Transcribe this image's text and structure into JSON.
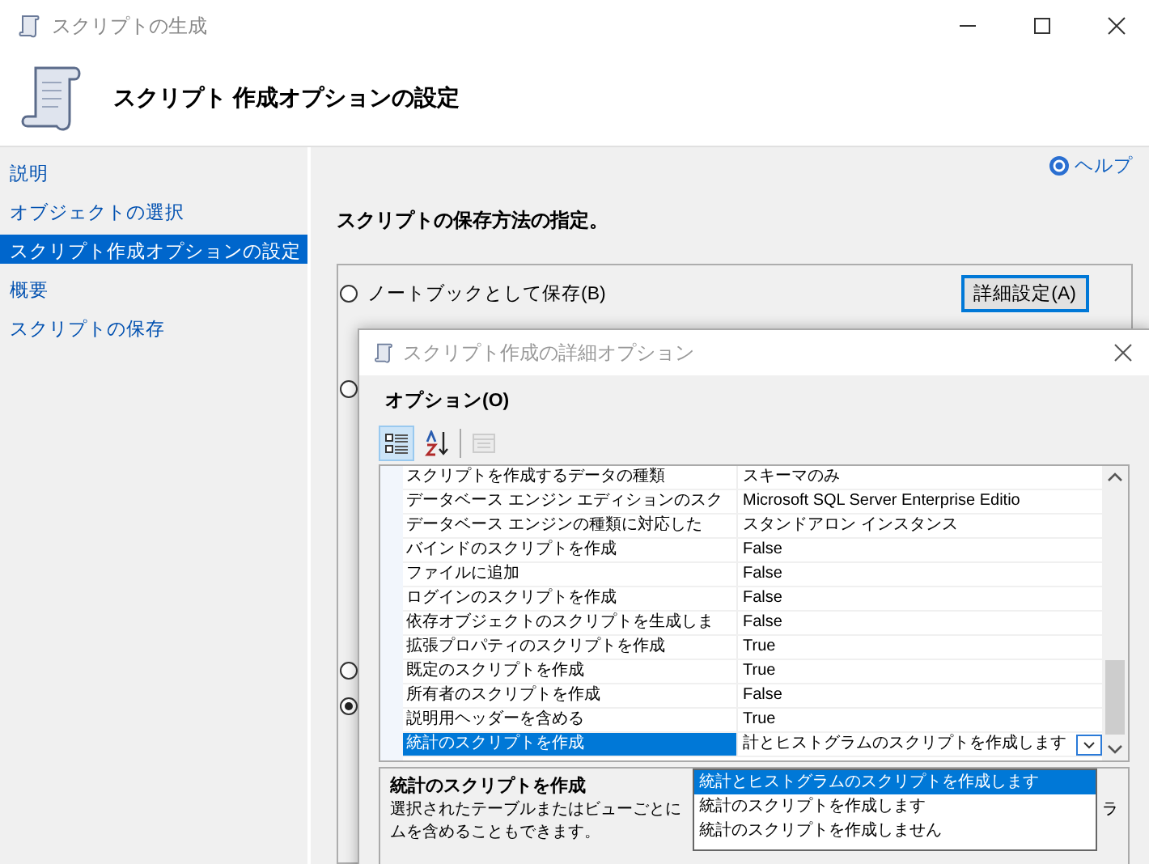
{
  "window": {
    "title": "スクリプトの生成"
  },
  "header": {
    "title": "スクリプト 作成オプションの設定"
  },
  "sidebar": {
    "items": [
      {
        "label": "説明",
        "selected": false
      },
      {
        "label": "オブジェクトの選択",
        "selected": false
      },
      {
        "label": "スクリプト作成オプションの設定",
        "selected": true
      },
      {
        "label": "概要",
        "selected": false
      },
      {
        "label": "スクリプトの保存",
        "selected": false
      }
    ]
  },
  "help_link": "ヘルプ",
  "heading": "スクリプトの保存方法の指定。",
  "save_options": [
    {
      "label": "ノートブックとして保存(B)",
      "selected": false
    },
    {
      "selected": false
    },
    {
      "selected": false
    },
    {
      "selected": true
    }
  ],
  "advanced_button": "詳細設定(A)",
  "dialog": {
    "title": "スクリプト作成の詳細オプション",
    "options_label": "オプション(O)",
    "toolbar": [
      {
        "kind": "categorized",
        "selected": true,
        "disabled": false
      },
      {
        "kind": "alphabetical",
        "selected": false,
        "disabled": false
      },
      {
        "kind": "property_pages",
        "selected": false,
        "disabled": true
      }
    ],
    "properties": [
      {
        "name": "スクリプトを作成するデータの種類",
        "value": "スキーマのみ",
        "selected": false
      },
      {
        "name": "データベース エンジン エディションのスク",
        "value": "Microsoft SQL Server Enterprise Editio",
        "selected": false
      },
      {
        "name": "データベース エンジンの種類に対応した",
        "value": "スタンドアロン インスタンス",
        "selected": false
      },
      {
        "name": "バインドのスクリプトを作成",
        "value": "False",
        "selected": false
      },
      {
        "name": "ファイルに追加",
        "value": "False",
        "selected": false
      },
      {
        "name": "ログインのスクリプトを作成",
        "value": "False",
        "selected": false
      },
      {
        "name": "依存オブジェクトのスクリプトを生成しま",
        "value": "False",
        "selected": false
      },
      {
        "name": "拡張プロパティのスクリプトを作成",
        "value": "True",
        "selected": false
      },
      {
        "name": "既定のスクリプトを作成",
        "value": "True",
        "selected": false
      },
      {
        "name": "所有者のスクリプトを作成",
        "value": "False",
        "selected": false
      },
      {
        "name": "説明用ヘッダーを含める",
        "value": "True",
        "selected": false
      },
      {
        "name": "統計のスクリプトを作成",
        "value": "計とヒストグラムのスクリプトを作成します",
        "selected": true
      }
    ],
    "dropdown_options": [
      {
        "label": "統計とヒストグラムのスクリプトを作成します",
        "selected": true
      },
      {
        "label": "統計のスクリプトを作成します",
        "selected": false
      },
      {
        "label": "統計のスクリプトを作成しません",
        "selected": false
      }
    ],
    "description": {
      "title": "統計のスクリプトを作成",
      "line_1_start": "選択されたテーブルまたはビューごとに",
      "line_1_end": "ラ",
      "line_2": "ムを含めることもできます。"
    }
  }
}
